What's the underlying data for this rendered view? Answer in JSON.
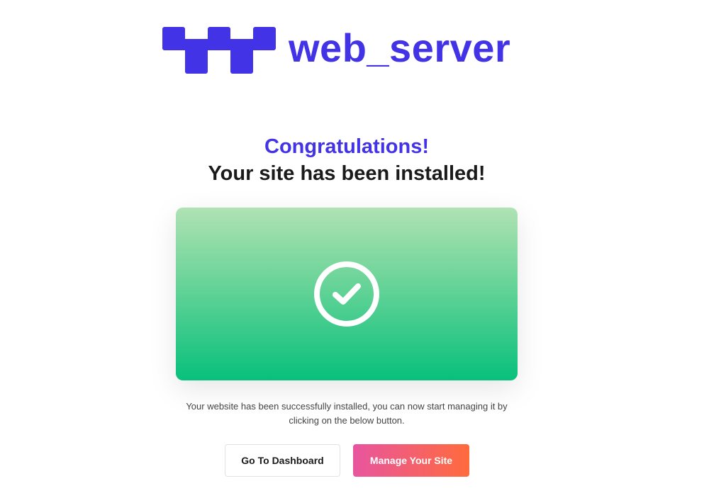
{
  "brand": {
    "name": "web_server",
    "color": "#4333e6"
  },
  "heading": {
    "congrats": "Congratulations!",
    "installed": "Your site has been installed!"
  },
  "success_card": {
    "icon": "check-circle-icon",
    "gradient_top": "#b0e2b4",
    "gradient_bottom": "#08c07c"
  },
  "description": "Your website has been successfully installed, you can now start managing it by clicking on the below button.",
  "buttons": {
    "dashboard_label": "Go To Dashboard",
    "manage_label": "Manage Your Site",
    "manage_gradient": [
      "#e8559f",
      "#ff6b3d"
    ]
  }
}
